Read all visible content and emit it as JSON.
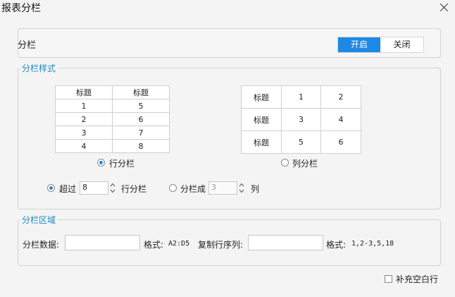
{
  "window": {
    "title": "报表分栏"
  },
  "column_toggle": {
    "label": "分栏",
    "on_label": "开启",
    "off_label": "关闭",
    "selected": "开启"
  },
  "style_section": {
    "title": "分栏样式",
    "row_preview": {
      "headers": [
        "标题",
        "标题"
      ],
      "rows": [
        [
          "1",
          "5"
        ],
        [
          "2",
          "6"
        ],
        [
          "3",
          "7"
        ],
        [
          "4",
          "8"
        ]
      ]
    },
    "column_preview": {
      "rows": [
        [
          "标题",
          "1",
          "2"
        ],
        [
          "标题",
          "3",
          "4"
        ],
        [
          "标题",
          "5",
          "6"
        ]
      ]
    },
    "row_option": {
      "label": "行分栏",
      "checked": true
    },
    "column_option": {
      "label": "列分栏",
      "checked": false
    },
    "exceed": {
      "label": "超过",
      "value": "8",
      "suffix": "行分栏",
      "checked": true
    },
    "split_into": {
      "label": "分栏成",
      "value": "3",
      "suffix": "列",
      "checked": false
    }
  },
  "area_section": {
    "title": "分栏区域",
    "data_label": "分栏数据:",
    "data_value": "",
    "data_format_label": "格式:",
    "data_format": "A2:D5",
    "copy_label": "复制行序列:",
    "copy_value": "",
    "copy_format_label": "格式:",
    "copy_format": "1,2-3,5,18"
  },
  "fill_blank": {
    "label": "补充空白行",
    "checked": false
  },
  "colors": {
    "accent": "#1e88e5",
    "section_title": "#1e88c7"
  }
}
